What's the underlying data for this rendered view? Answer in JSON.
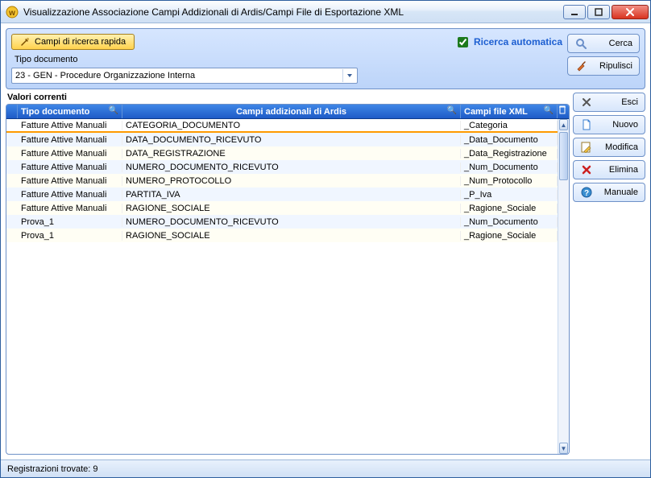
{
  "window": {
    "title": "Visualizzazione Associazione Campi Addizionali di Ardis/Campi File di Esportazione XML"
  },
  "toolbar": {
    "quick_search": "Campi di ricerca rapida",
    "auto_search": "Ricerca automatica",
    "auto_search_checked": true,
    "search": "Cerca",
    "clear": "Ripulisci"
  },
  "filter": {
    "doc_type_label": "Tipo documento",
    "doc_type_value": "23 - GEN - Procedure Organizzazione Interna"
  },
  "grid": {
    "section": "Valori correnti",
    "columns": {
      "doc_type": "Tipo documento",
      "ardis_fields": "Campi addizionali di Ardis",
      "xml_fields": "Campi file XML"
    },
    "rows": [
      {
        "doc": "Fatture Attive Manuali",
        "ardis": "CATEGORIA_DOCUMENTO",
        "xml": "_Categoria"
      },
      {
        "doc": "Fatture Attive Manuali",
        "ardis": "DATA_DOCUMENTO_RICEVUTO",
        "xml": "_Data_Documento"
      },
      {
        "doc": "Fatture Attive Manuali",
        "ardis": "DATA_REGISTRAZIONE",
        "xml": "_Data_Registrazione"
      },
      {
        "doc": "Fatture Attive Manuali",
        "ardis": "NUMERO_DOCUMENTO_RICEVUTO",
        "xml": "_Num_Documento"
      },
      {
        "doc": "Fatture Attive Manuali",
        "ardis": "NUMERO_PROTOCOLLO",
        "xml": "_Num_Protocollo"
      },
      {
        "doc": "Fatture Attive Manuali",
        "ardis": "PARTITA_IVA",
        "xml": "_P_Iva"
      },
      {
        "doc": "Fatture Attive Manuali",
        "ardis": "RAGIONE_SOCIALE",
        "xml": "_Ragione_Sociale"
      },
      {
        "doc": "Prova_1",
        "ardis": "NUMERO_DOCUMENTO_RICEVUTO",
        "xml": "_Num_Documento"
      },
      {
        "doc": "Prova_1",
        "ardis": "RAGIONE_SOCIALE",
        "xml": "_Ragione_Sociale"
      }
    ]
  },
  "actions": {
    "exit": "Esci",
    "new": "Nuovo",
    "edit": "Modifica",
    "delete": "Elimina",
    "manual": "Manuale"
  },
  "status": {
    "text": "Registrazioni trovate: 9"
  },
  "icons": {
    "app": "app-icon",
    "wand": "wand-icon",
    "search": "search-icon",
    "broom": "broom-icon",
    "exit": "close-x-icon",
    "new": "page-icon",
    "edit": "pencil-icon",
    "delete": "delete-x-icon",
    "manual": "help-icon",
    "dropdown": "chevron-down-icon"
  }
}
